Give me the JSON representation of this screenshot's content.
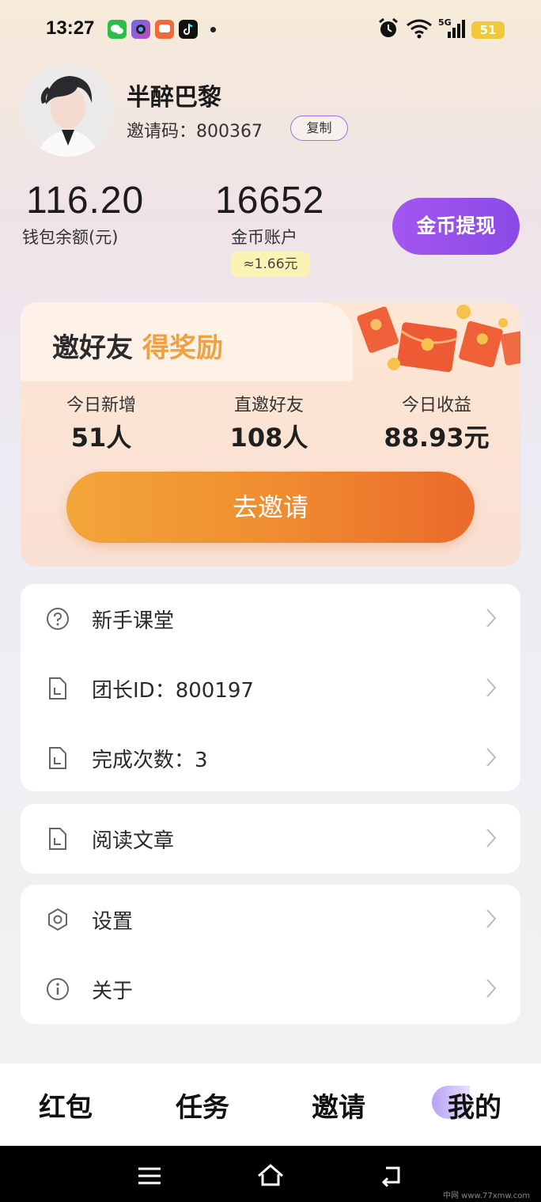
{
  "status_bar": {
    "time": "13:27",
    "apps": [
      "wechat-icon",
      "camera-app-icon",
      "weibo-icon",
      "tiktok-icon"
    ],
    "network": "5G",
    "battery": "51"
  },
  "profile": {
    "username": "半醉巴黎",
    "invite_code_label": "邀请码：800367",
    "copy_label": "复制"
  },
  "balances": {
    "wallet_value": "116.20",
    "wallet_label": "钱包余额(元)",
    "coin_value": "16652",
    "coin_label": "金币账户",
    "coin_equiv": "≈1.66元",
    "withdraw_label": "金币提现"
  },
  "invite_card": {
    "title_part1": "邀好友",
    "title_part2": "得奖励",
    "stats": [
      {
        "label": "今日新增",
        "value": "51人"
      },
      {
        "label": "直邀好友",
        "value": "108人"
      },
      {
        "label": "今日收益",
        "value": "88.93元"
      }
    ],
    "button_label": "去邀请"
  },
  "menu_group1": [
    {
      "label": "新手课堂",
      "icon": "question-icon"
    },
    {
      "label": "团长ID：800197",
      "icon": "document-icon"
    },
    {
      "label": "完成次数：3",
      "icon": "document-icon"
    }
  ],
  "menu_group2": [
    {
      "label": "阅读文章",
      "icon": "document-icon"
    }
  ],
  "menu_group3": [
    {
      "label": "设置",
      "icon": "settings-icon"
    },
    {
      "label": "关于",
      "icon": "info-icon"
    }
  ],
  "bottom_nav": {
    "items": [
      "红包",
      "任务",
      "邀请",
      "我的"
    ],
    "active": "我的"
  },
  "watermark": "中网 www.77xmw.com",
  "colors": {
    "accent_purple": "#9a52ec",
    "invite_orange": "#f08a30",
    "highlight_gold": "#f2a03e"
  }
}
